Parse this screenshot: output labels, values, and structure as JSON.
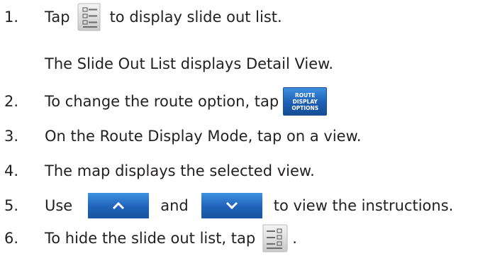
{
  "steps": [
    {
      "num": "1.",
      "before": "Tap",
      "after": "to display slide out list."
    },
    {
      "note": "The Slide Out List displays Detail View."
    },
    {
      "num": "2.",
      "text": "To change the route option, tap"
    },
    {
      "num": "3.",
      "text": " On the Route Display Mode, tap on a view."
    },
    {
      "num": "4.",
      "text": "The map displays the selected view."
    },
    {
      "num": "5.",
      "before": " Use",
      "middle": "and",
      "after": "to view the instructions."
    },
    {
      "num": "6.",
      "text": "To hide the slide out list, tap",
      "after": "."
    }
  ],
  "route_button": {
    "line1": "ROUTE",
    "line2": "DISPLAY",
    "line3": "OPTIONS"
  },
  "icons": {
    "list_icon": "list-icon",
    "up_arrow": "chevron-up-icon",
    "down_arrow": "chevron-down-icon",
    "hide_list_icon": "list-icon"
  },
  "colors": {
    "text": "#231f20",
    "button_blue": "#1d5fb4"
  }
}
